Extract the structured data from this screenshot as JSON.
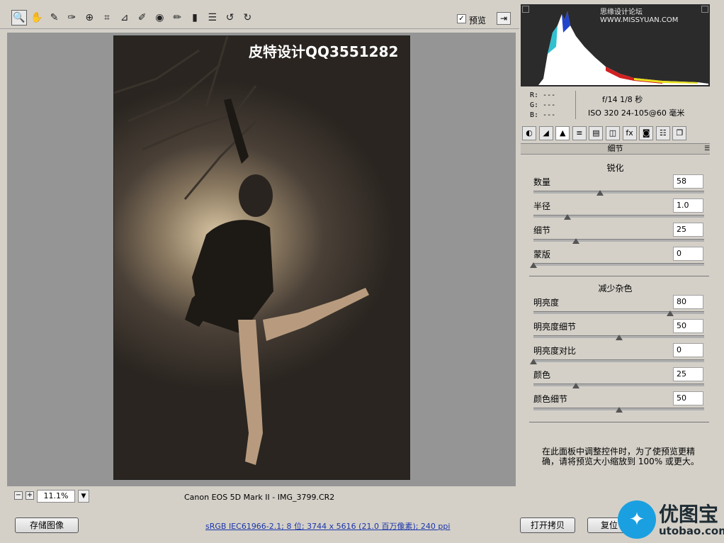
{
  "toolbar": {
    "tools": [
      {
        "name": "zoom-tool-icon",
        "glyph": "🔍"
      },
      {
        "name": "hand-tool-icon",
        "glyph": "✋"
      },
      {
        "name": "white-balance-tool-icon",
        "glyph": "✎"
      },
      {
        "name": "color-sampler-tool-icon",
        "glyph": "✑"
      },
      {
        "name": "target-adjustment-tool-icon",
        "glyph": "⊕"
      },
      {
        "name": "crop-tool-icon",
        "glyph": "⌗"
      },
      {
        "name": "straighten-tool-icon",
        "glyph": "⊿"
      },
      {
        "name": "spot-removal-tool-icon",
        "glyph": "✐"
      },
      {
        "name": "red-eye-tool-icon",
        "glyph": "◉"
      },
      {
        "name": "adjustment-brush-icon",
        "glyph": "✏"
      },
      {
        "name": "graduated-filter-icon",
        "glyph": "▮"
      },
      {
        "name": "preferences-icon",
        "glyph": "☰"
      },
      {
        "name": "rotate-ccw-icon",
        "glyph": "↺"
      },
      {
        "name": "rotate-cw-icon",
        "glyph": "↻"
      }
    ],
    "preview_label": "预览",
    "preview_checked": "✓",
    "fullscreen_glyph": "⇥"
  },
  "photo": {
    "watermark": "皮特设计QQ3551282"
  },
  "status": {
    "zoom_minus": "−",
    "zoom_plus": "+",
    "zoom_value": "11.1%",
    "zoom_dropdown": "▼",
    "camera_info": "Canon EOS 5D Mark II -  IMG_3799.CR2"
  },
  "histogram": {
    "site_watermark": "思缘设计论坛  WWW.MISSYUAN.COM"
  },
  "readout": {
    "r": "R:  ---",
    "g": "G:  ---",
    "b": "B:  ---",
    "exif_line1": "f/14  1/8 秒",
    "exif_line2": "ISO 320  24-105@60 毫米"
  },
  "tabs": [
    {
      "name": "tab-basic-icon",
      "glyph": "◐",
      "active": false
    },
    {
      "name": "tab-tone-curve-icon",
      "glyph": "◢",
      "active": false
    },
    {
      "name": "tab-detail-icon",
      "glyph": "▲",
      "active": true
    },
    {
      "name": "tab-hsl-icon",
      "glyph": "≡",
      "active": false
    },
    {
      "name": "tab-split-toning-icon",
      "glyph": "▤",
      "active": false
    },
    {
      "name": "tab-lens-corrections-icon",
      "glyph": "◫",
      "active": false
    },
    {
      "name": "tab-effects-icon",
      "glyph": "fx",
      "active": false
    },
    {
      "name": "tab-camera-calibration-icon",
      "glyph": "◙",
      "active": false
    },
    {
      "name": "tab-presets-icon",
      "glyph": "☷",
      "active": false
    },
    {
      "name": "tab-snapshots-icon",
      "glyph": "❐",
      "active": false
    }
  ],
  "panel": {
    "title": "细节",
    "menu_glyph": "☰",
    "sharpening_title": "锐化",
    "noise_title": "减少杂色",
    "sharpening": [
      {
        "label": "数量",
        "value": "58",
        "pos": 0.39
      },
      {
        "label": "半径",
        "value": "1.0",
        "pos": 0.2
      },
      {
        "label": "细节",
        "value": "25",
        "pos": 0.25
      },
      {
        "label": "蒙版",
        "value": "0",
        "pos": 0.0
      }
    ],
    "noise": [
      {
        "label": "明亮度",
        "value": "80",
        "pos": 0.8
      },
      {
        "label": "明亮度细节",
        "value": "50",
        "pos": 0.5
      },
      {
        "label": "明亮度对比",
        "value": "0",
        "pos": 0.0
      },
      {
        "label": "颜色",
        "value": "25",
        "pos": 0.25
      },
      {
        "label": "颜色细节",
        "value": "50",
        "pos": 0.5
      }
    ],
    "hint": "在此面板中调整控件时，为了使预览更精确，请将预览大小缩放到 100% 或更大。"
  },
  "bottom": {
    "save_label": "存储图像",
    "workflow_link": "sRGB IEC61966-2.1; 8 位; 3744 x 5616 (21.0 百万像素); 240 ppi",
    "open_copy_label": "打开拷贝",
    "reset_label": "复位"
  },
  "logo": {
    "text": "优图宝",
    "url": "utobao.com"
  },
  "colors": {
    "accent_link": "#1a35a8",
    "logo_blue": "#1aa0e0"
  }
}
